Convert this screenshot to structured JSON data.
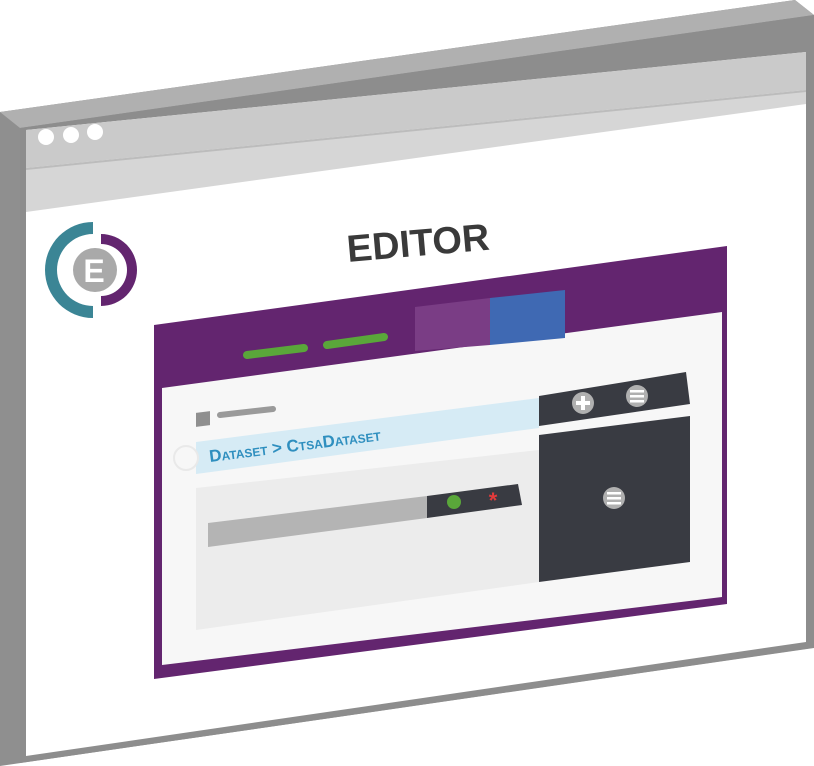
{
  "window": {
    "title": "EDITOR",
    "traffic_lights": [
      "dot",
      "dot",
      "dot"
    ]
  },
  "logo": {
    "letter": "E"
  },
  "app": {
    "nav_tabs": [
      "green-dash-tab",
      "green-dash-tab"
    ],
    "breadcrumb": "Dataset > CtsaDataset",
    "toolbar_icons": [
      "plus-circle-icon",
      "menu-lines-icon"
    ],
    "side_panel_icon": "menu-lines-icon",
    "field_status_icons": [
      "green-dot-icon",
      "red-asterisk-icon"
    ]
  },
  "colors": {
    "frame_outer": "#8f8f8f",
    "frame_inner": "#d4d4d4",
    "purple": "#63256f",
    "blue_tab": "#3f69b3",
    "green": "#5aa73a",
    "dark_panel": "#393b42",
    "breadcrumb_bg": "#d6ebf5",
    "breadcrumb_text": "#2f8fbf",
    "red": "#e33b3b"
  }
}
